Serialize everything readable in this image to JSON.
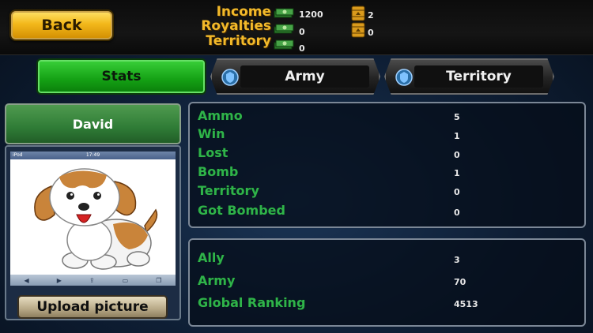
{
  "header": {
    "back_label": "Back",
    "income_label": "Income",
    "royalties_label": "Royalties",
    "territory_label": "Territory",
    "income_value": "1200",
    "royalties_value": "0",
    "territory_value": "0",
    "barrel_top_value": "2",
    "barrel_bottom_value": "0",
    "cash_icon": "cash-stack-icon",
    "barrel_icon": "oil-barrel-icon"
  },
  "tabs": [
    {
      "label": "Stats",
      "active": true
    },
    {
      "label": "Army",
      "active": false
    },
    {
      "label": "Territory",
      "active": false
    }
  ],
  "profile": {
    "name": "David",
    "upload_label": "Upload picture",
    "phone_carrier": "iPod",
    "phone_time": "17:49"
  },
  "stats": [
    {
      "label": "Ammo",
      "value": "5"
    },
    {
      "label": "Win",
      "value": "1"
    },
    {
      "label": "Lost",
      "value": "0"
    },
    {
      "label": "Bomb",
      "value": "1"
    },
    {
      "label": "Territory",
      "value": "0"
    },
    {
      "label": "Got Bombed",
      "value": "0"
    }
  ],
  "summary": [
    {
      "label": "Ally",
      "value": "3"
    },
    {
      "label": "Army",
      "value": "70"
    },
    {
      "label": "Global Ranking",
      "value": "4513"
    }
  ],
  "colors": {
    "stat_label": "#2fb34a",
    "header_label": "#f2b92a",
    "active_tab": "#1aa81a"
  }
}
